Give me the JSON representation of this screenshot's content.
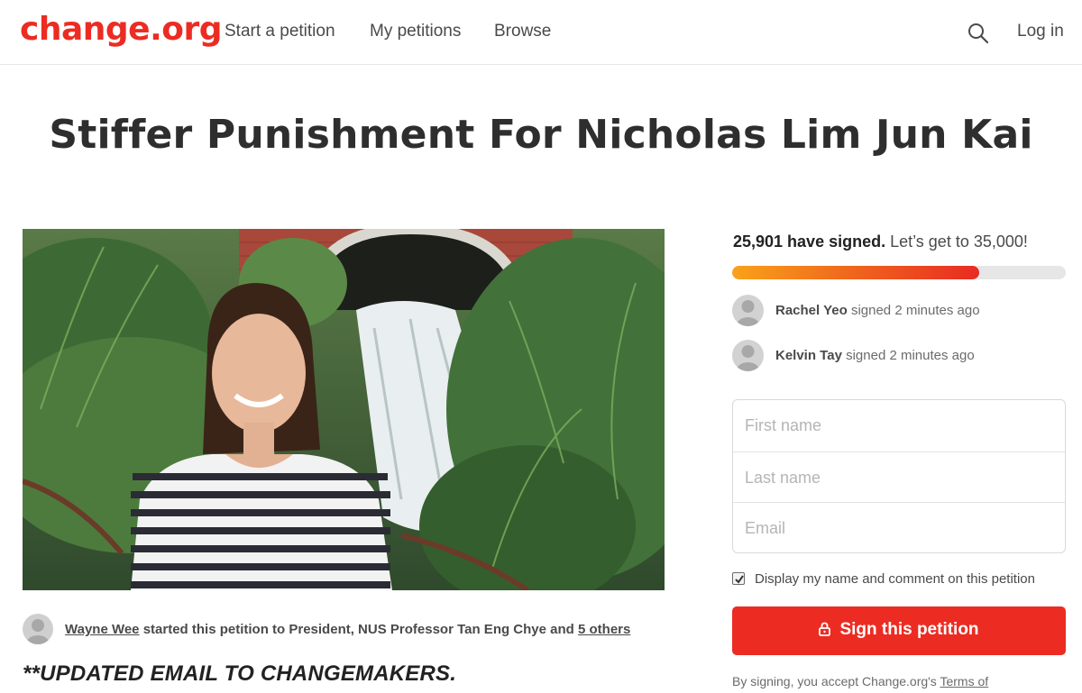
{
  "brand": {
    "logo_text": "change.org",
    "accent_color": "#ec2c22"
  },
  "nav": {
    "start_petition": "Start a petition",
    "my_petitions": "My petitions",
    "browse": "Browse",
    "search_icon": "search-icon",
    "login": "Log in"
  },
  "petition": {
    "title": "Stiffer Punishment For Nicholas Lim Jun Kai",
    "photo_icon": "petition-photo",
    "starter": {
      "name": "Wayne Wee",
      "middle": " started this petition to President, NUS Professor Tan Eng Chye and ",
      "others": "5 others"
    },
    "updated_heading": "**UPDATED EMAIL TO CHANGEMAKERS."
  },
  "signatures": {
    "count_text": "25,901 have signed.",
    "goal_text": " Let’s get to 35,000!",
    "progress_fraction": 0.74,
    "recent": [
      {
        "name": "Rachel Yeo",
        "action": " signed 2 minutes ago"
      },
      {
        "name": "Kelvin Tay",
        "action": " signed 2 minutes ago"
      }
    ]
  },
  "form": {
    "first_name_placeholder": "First name",
    "last_name_placeholder": "Last name",
    "email_placeholder": "Email",
    "consent_checked": true,
    "consent_label": "Display my name and comment on this petition",
    "sign_button": "Sign this petition",
    "terms_prefix": "By signing, you accept Change.org's ",
    "terms_link": "Terms of"
  }
}
